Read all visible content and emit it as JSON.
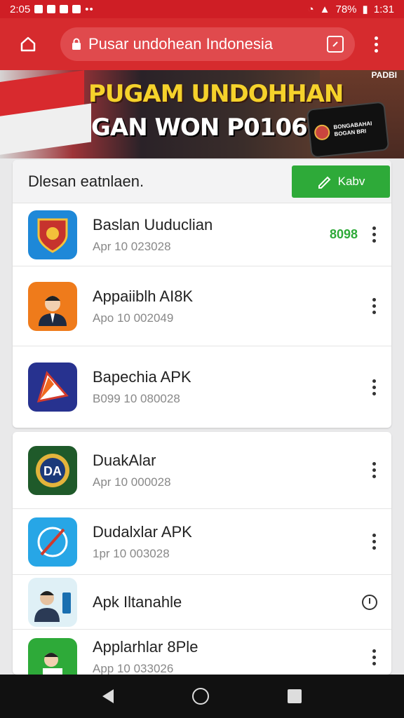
{
  "status": {
    "time": "2:05",
    "right_text": "78%",
    "right_time": "1:31"
  },
  "topbar": {
    "url": "Pusar undohean Indonesia"
  },
  "banner": {
    "title": "PUGAM UNDOHHAN",
    "subtitle": "GAN WON P01069N",
    "tag": "PADBI",
    "phone_text": "BONGABAHAI BOGAN BRI"
  },
  "card1": {
    "header_title": "Dlesan eatnlaen.",
    "add_label": "Kabv",
    "rows": [
      {
        "name": "Baslan Uuduclian",
        "date": "Apr 10 023028",
        "badge": "8098"
      },
      {
        "name": "Appaiiblh AI8K",
        "date": "Apo 10 002049"
      },
      {
        "name": "Bapechia APK",
        "date": "B099 10 080028"
      }
    ]
  },
  "card2": {
    "rows": [
      {
        "name": "DuakAlar",
        "date": "Apr 10 000028"
      },
      {
        "name": "Dudalxlar APK",
        "date": "1pr 10 003028"
      },
      {
        "name": "Apk Iltanahle",
        "date": ""
      },
      {
        "name": "Applarhlar 8Ple",
        "date": "App 10 033026"
      }
    ]
  },
  "icons": {
    "home": "home-icon",
    "lock": "lock-icon",
    "tabs": "tabs-icon",
    "menu": "more-vert-icon",
    "edit": "edit-icon",
    "clock": "clock-icon"
  },
  "colors": {
    "brand_red": "#d62b2e",
    "accent_green": "#2eaa39"
  }
}
